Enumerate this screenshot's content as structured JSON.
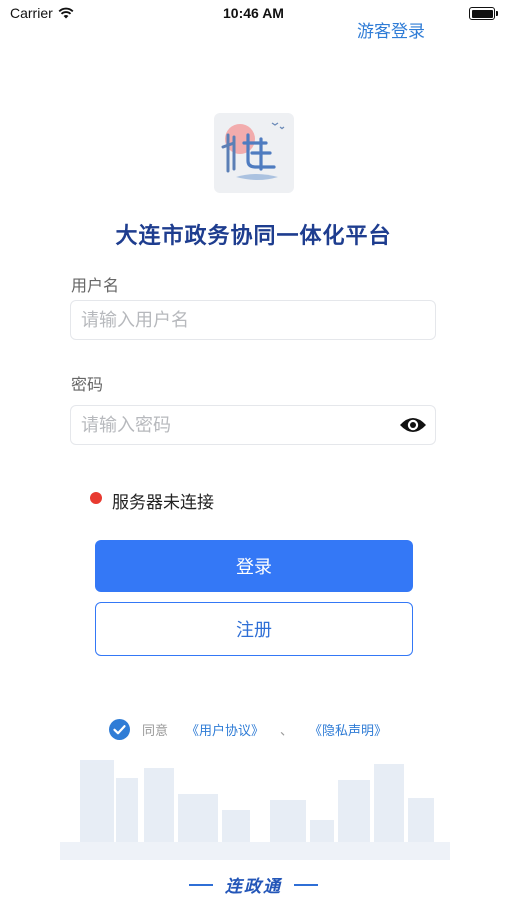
{
  "status_bar": {
    "carrier": "Carrier",
    "time": "10:46 AM"
  },
  "header": {
    "guest_login": "游客登录"
  },
  "app": {
    "title": "大连市政务协同一体化平台"
  },
  "form": {
    "username_label": "用户名",
    "username_placeholder": "请输入用户名",
    "username_value": "",
    "password_label": "密码",
    "password_placeholder": "请输入密码",
    "password_value": ""
  },
  "server": {
    "status_text": "服务器未连接",
    "status_color": "#e83a30"
  },
  "buttons": {
    "login": "登录",
    "register": "注册"
  },
  "agreement": {
    "checked": true,
    "agree": "同意",
    "user_agreement": "《用户协议》",
    "separator": "、",
    "privacy_policy": "《隐私声明》"
  },
  "footer": {
    "brand": "连政通"
  },
  "colors": {
    "accent": "#3478f6",
    "title": "#1e3d8f",
    "link": "#2f7cd6"
  }
}
